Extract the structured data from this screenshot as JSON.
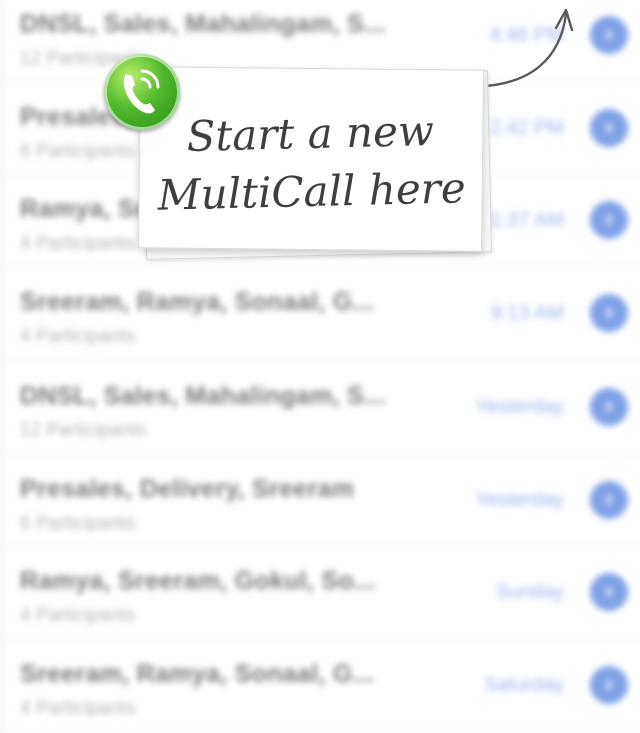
{
  "rows": [
    {
      "name": "DNSL, Sales, Mahalingam, S...",
      "participants": "12 Participants",
      "time": "4:46 PM"
    },
    {
      "name": "Presales, Delivery, Sreeram",
      "participants": "6 Participants",
      "time": "2:42 PM"
    },
    {
      "name": "Ramya, Sreeram, Gokul, So...",
      "participants": "4 Participants",
      "time": "11:37 AM"
    },
    {
      "name": "Sreeram, Ramya, Sonaal, G...",
      "participants": "4 Participants",
      "time": "9:13 AM"
    },
    {
      "name": "DNSL, Sales, Mahalingam, S...",
      "participants": "12 Participants",
      "time": "Yesterday"
    },
    {
      "name": "Presales, Delivery, Sreeram",
      "participants": "6 Participants",
      "time": "Yesterday"
    },
    {
      "name": "Ramya, Sreeram, Gokul, So...",
      "participants": "4 Participants",
      "time": "Sunday"
    },
    {
      "name": "Sreeram, Ramya, Sonaal, G...",
      "participants": "4 Participants",
      "time": "Saturday"
    }
  ],
  "callout": {
    "line1": "Start a new",
    "line2": "MultiCall here",
    "icon": "multicall-phone-icon"
  },
  "disclosure_icon": "›",
  "colors": {
    "accent": "#7ea1e6",
    "badge_green": "#4fb82b"
  }
}
